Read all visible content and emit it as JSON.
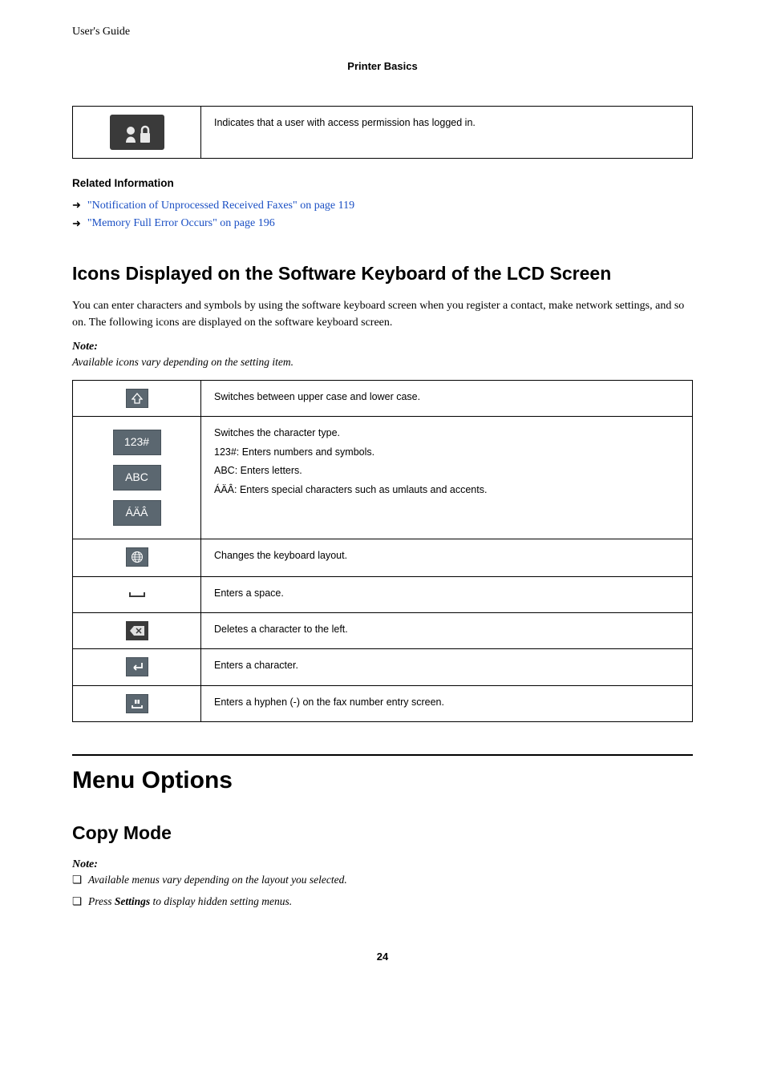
{
  "header": {
    "guide": "User's Guide",
    "section": "Printer Basics"
  },
  "table1": {
    "row1_desc": "Indicates that a user with access permission has logged in."
  },
  "related": {
    "heading": "Related Information",
    "links": [
      "\"Notification of Unprocessed Received Faxes\" on page 119",
      "\"Memory Full Error Occurs\" on page 196"
    ]
  },
  "section_icons": {
    "title": "Icons Displayed on the Software Keyboard of the LCD Screen",
    "intro": "You can enter characters and symbols by using the software keyboard screen when you register a contact, make network settings, and so on. The following icons are displayed on the software keyboard screen.",
    "note_label": "Note:",
    "note_text": "Available icons vary depending on the setting item.",
    "rows": [
      {
        "desc": "Switches between upper case and lower case."
      },
      {
        "desc": "Switches the character type.",
        "lines": [
          "123#: Enters numbers and symbols.",
          "ABC: Enters letters.",
          "ÁÄÂ: Enters special characters such as umlauts and accents."
        ],
        "labels": {
          "a": "123#",
          "b": "ABC",
          "c": "ÁÄÂ"
        }
      },
      {
        "desc": "Changes the keyboard layout."
      },
      {
        "desc": "Enters a space."
      },
      {
        "desc": "Deletes a character to the left."
      },
      {
        "desc": "Enters a character."
      },
      {
        "desc": "Enters a hyphen (-) on the fax number entry screen."
      }
    ]
  },
  "menu_options": {
    "title": "Menu Options",
    "copy_mode": "Copy Mode",
    "note_label": "Note:",
    "notes": [
      "Available menus vary depending on the layout you selected.",
      "Press Settings to display hidden setting menus."
    ],
    "settings_word": "Settings"
  },
  "page_number": "24"
}
